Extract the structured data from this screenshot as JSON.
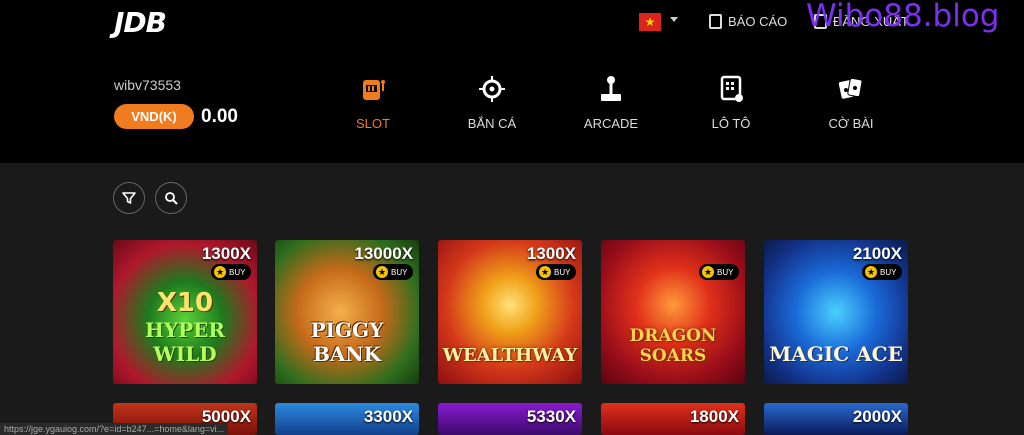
{
  "header": {
    "logo": "JDB",
    "watermark": "Wibo88.blog",
    "report_label": "BÁO CÁO",
    "logout_label": "ĐĂNG XUẤT",
    "language_flag": "vietnam-flag-icon"
  },
  "account": {
    "username": "wibv73553",
    "currency": "VND(K)",
    "balance": "0.00"
  },
  "nav": {
    "items": [
      {
        "label": "SLOT",
        "icon": "slot-machine-icon",
        "active": true
      },
      {
        "label": "BẮN CÁ",
        "icon": "crosshair-icon",
        "active": false
      },
      {
        "label": "ARCADE",
        "icon": "joystick-icon",
        "active": false
      },
      {
        "label": "LÔ TÔ",
        "icon": "lottery-icon",
        "active": false
      },
      {
        "label": "CỜ BÀI",
        "icon": "cards-icon",
        "active": false
      }
    ]
  },
  "tools": {
    "filter_icon": "filter-icon",
    "search_icon": "search-icon"
  },
  "games": [
    {
      "name": "HYPER WILD",
      "badge": "X10",
      "multiplier": "1300X",
      "buy": "BUY"
    },
    {
      "name": "PIGGY BANK",
      "badge": "",
      "multiplier": "13000X",
      "buy": "BUY"
    },
    {
      "name": "WEALTHWAY",
      "badge": "",
      "multiplier": "1300X",
      "buy": "BUY"
    },
    {
      "name": "DRAGON SOARS",
      "badge": "",
      "multiplier": "",
      "buy": "BUY"
    },
    {
      "name": "MAGIC ACE",
      "badge": "",
      "multiplier": "2100X",
      "buy": "BUY"
    }
  ],
  "games_row2": [
    {
      "multiplier": "5000X"
    },
    {
      "multiplier": "3300X"
    },
    {
      "multiplier": "5330X"
    },
    {
      "multiplier": "1800X"
    },
    {
      "multiplier": "2000X"
    }
  ],
  "status_url": "https://jge.ygauiog.com/?e=id=b247...=home&lang=vi..."
}
